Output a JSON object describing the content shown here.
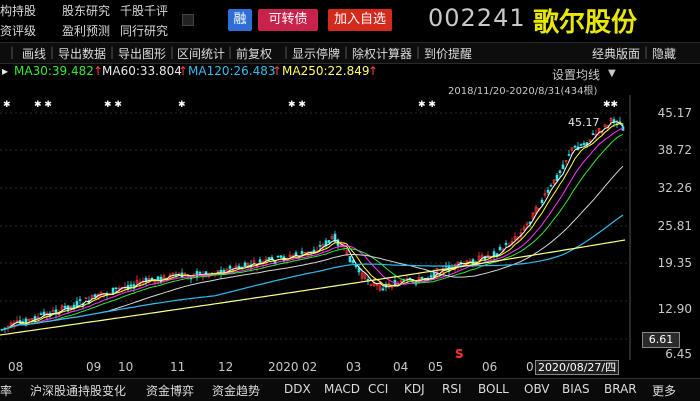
{
  "nav": {
    "row1": [
      "构持股",
      "股东研究",
      "千股千评"
    ],
    "row2": [
      "资评级",
      "盈利预测",
      "同行研究"
    ]
  },
  "buttons": {
    "rong": "融",
    "convertible": "可转债",
    "add_watchlist": "加入自选"
  },
  "stock": {
    "code": "002241",
    "name": "歌尔股份"
  },
  "toolbar": [
    "画线",
    "导出数据",
    "导出图形",
    "区间统计",
    "前复权",
    "显示停牌",
    "除权计算器",
    "到价提醒",
    "经典版面",
    "隐藏"
  ],
  "ma": [
    {
      "label": "MA30:39.482",
      "color": "#35e835"
    },
    {
      "label": "MA60:33.804",
      "color": "#e8e8e8"
    },
    {
      "label": "MA120:26.483",
      "color": "#33bbee"
    },
    {
      "label": "MA250:22.849",
      "color": "#ffff66"
    }
  ],
  "settings_label": "设置均线",
  "date_range": "2018/11/20-2020/8/31(434根)",
  "peak_label": "45.17",
  "y_labels": [
    "45.17",
    "38.72",
    "32.26",
    "25.81",
    "19.35",
    "12.90",
    "6.45"
  ],
  "current_price": "6.61",
  "x_labels": [
    "08",
    "09",
    "10",
    "11",
    "12",
    "2020",
    "02",
    "03",
    "04",
    "05",
    "06",
    "0"
  ],
  "current_date": "2020/08/27/四",
  "s_marker": "S",
  "bottom_tabs": [
    "率",
    "沪深股通持股变化",
    "资金博弈",
    "资金趋势",
    "DDX",
    "MACD",
    "CCI",
    "KDJ",
    "RSI",
    "BOLL",
    "OBV",
    "BIAS",
    "BRAR",
    "更多"
  ]
}
